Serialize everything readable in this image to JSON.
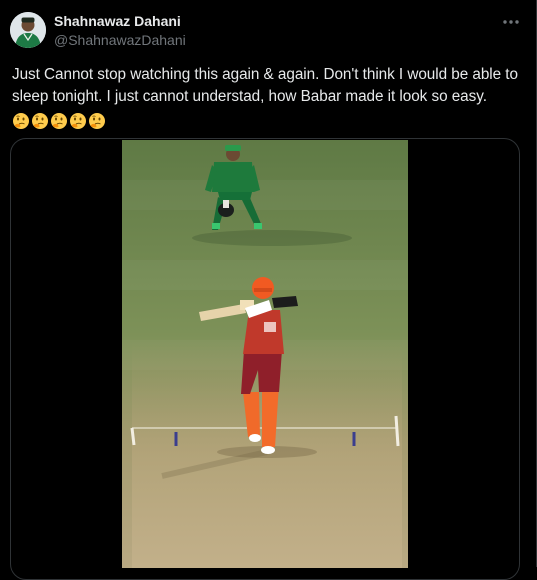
{
  "tweet": {
    "author_name": "Shahnawaz Dahani",
    "author_handle": "@ShahnawazDahani",
    "text": "Just Cannot stop watching this again & again. Don't think I would be able to sleep tonight. I just cannot understad, how Babar made it look so easy.",
    "emojis": [
      "thinking-face",
      "thinking-face",
      "thinking-face",
      "thinking-face",
      "thinking-face"
    ],
    "more_icon": "more-horizontal-icon",
    "media_type": "video"
  },
  "colors": {
    "background": "#000000",
    "text_primary": "#e7e9ea",
    "text_secondary": "#71767b",
    "border": "#2f3336",
    "pitch_green": "#6f8a4c",
    "pitch_strip": "#b3a47c",
    "batsman_kit": "#c0392b",
    "batsman_pads": "#f06a2a",
    "keeper_kit": "#1e7a3c"
  }
}
